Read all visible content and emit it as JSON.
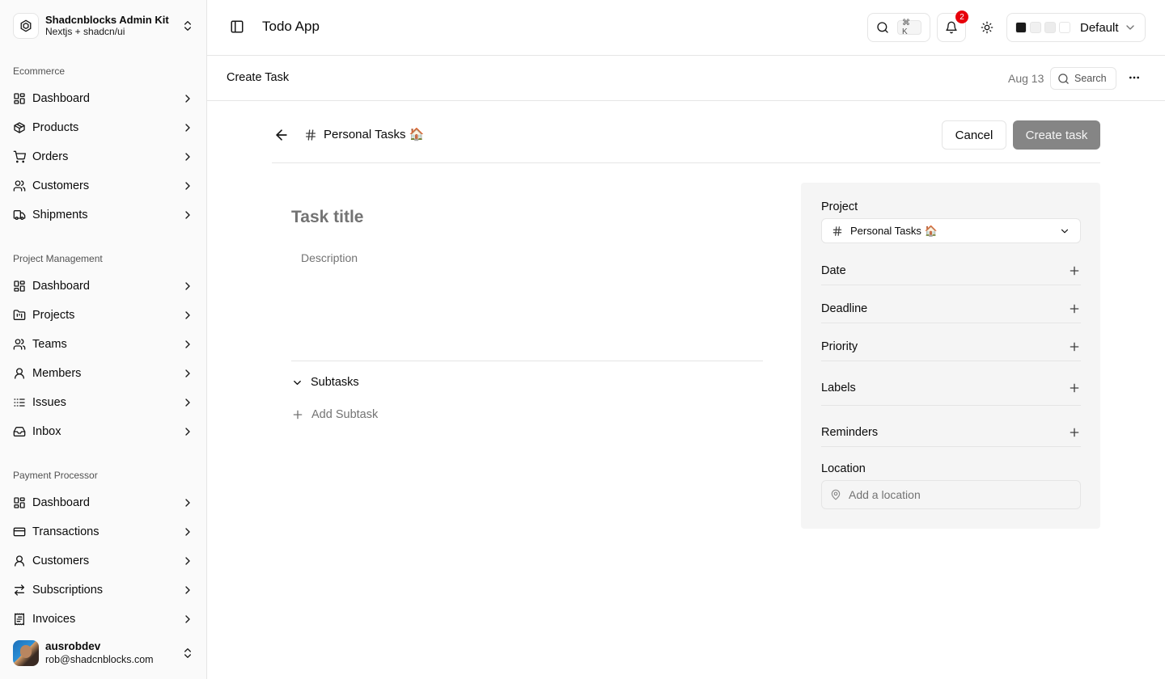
{
  "sidebar": {
    "org": {
      "name": "Shadcnblocks Admin Kit",
      "subtitle": "Nextjs + shadcn/ui"
    },
    "groups": [
      {
        "label": "Ecommerce",
        "items": [
          {
            "label": "Dashboard",
            "icon": "dashboard-icon"
          },
          {
            "label": "Products",
            "icon": "package-icon"
          },
          {
            "label": "Orders",
            "icon": "cart-icon"
          },
          {
            "label": "Customers",
            "icon": "users-icon"
          },
          {
            "label": "Shipments",
            "icon": "truck-icon"
          }
        ]
      },
      {
        "label": "Project Management",
        "items": [
          {
            "label": "Dashboard",
            "icon": "dashboard-icon"
          },
          {
            "label": "Projects",
            "icon": "folder-icon"
          },
          {
            "label": "Teams",
            "icon": "users-icon"
          },
          {
            "label": "Members",
            "icon": "user-icon"
          },
          {
            "label": "Issues",
            "icon": "list-icon"
          },
          {
            "label": "Inbox",
            "icon": "inbox-icon"
          }
        ]
      },
      {
        "label": "Payment Processor",
        "items": [
          {
            "label": "Dashboard",
            "icon": "dashboard-icon"
          },
          {
            "label": "Transactions",
            "icon": "credit-card-icon"
          },
          {
            "label": "Customers",
            "icon": "user-icon"
          },
          {
            "label": "Subscriptions",
            "icon": "repeat-icon"
          },
          {
            "label": "Invoices",
            "icon": "receipt-icon"
          }
        ]
      }
    ],
    "user": {
      "name": "ausrobdev",
      "email": "rob@shadcnblocks.com"
    }
  },
  "header": {
    "title": "Todo App",
    "search_shortcut": "⌘ K",
    "notification_count": "2",
    "theme_label": "Default",
    "theme_swatches": [
      "#1a1a1a",
      "#f0f0f0",
      "#ececec",
      "#ffffff"
    ],
    "badge_color": "#e7000b"
  },
  "subheader": {
    "title": "Create Task",
    "date": "Aug 13",
    "search_label": "Search"
  },
  "task": {
    "project_name": "Personal Tasks 🏠",
    "cancel_label": "Cancel",
    "create_label": "Create task",
    "title_placeholder": "Task title",
    "description_placeholder": "Description",
    "subtasks_label": "Subtasks",
    "add_subtask_label": "Add Subtask"
  },
  "panel": {
    "project_label": "Project",
    "project_value": "Personal Tasks 🏠",
    "date_label": "Date",
    "deadline_label": "Deadline",
    "priority_label": "Priority",
    "labels_label": "Labels",
    "reminders_label": "Reminders",
    "location_label": "Location",
    "location_placeholder": "Add a location"
  }
}
